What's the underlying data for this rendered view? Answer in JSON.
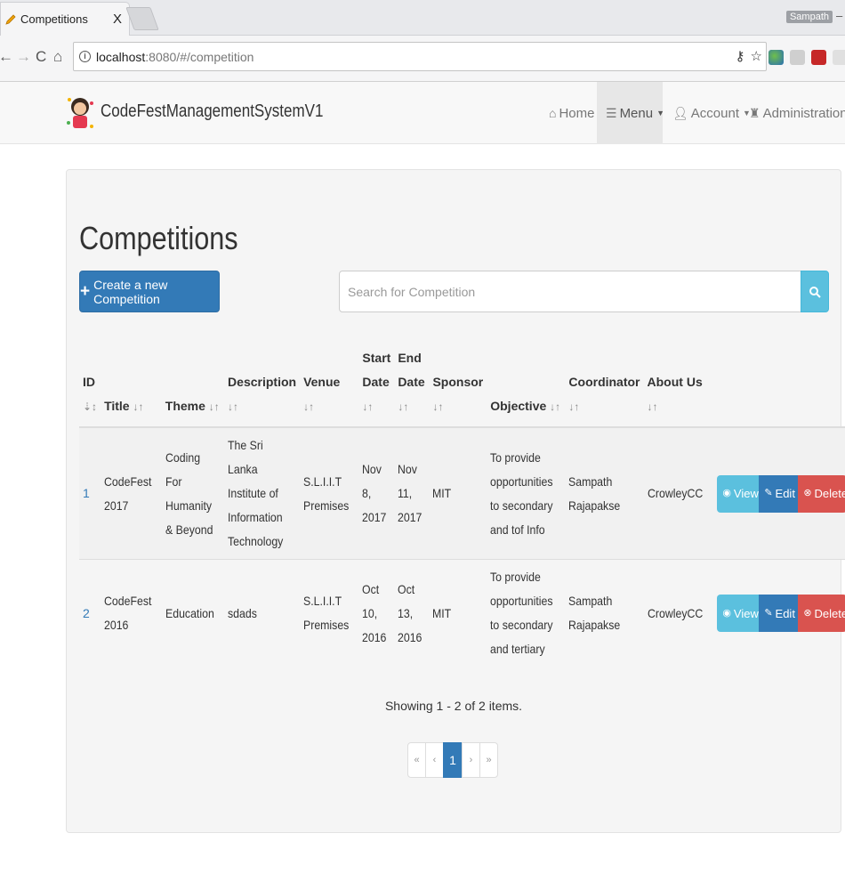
{
  "browser": {
    "tab_title": "Competitions",
    "tab_close": "X",
    "profile_name": "Sampath",
    "url_host": "localhost",
    "url_rest": ":8080/#/competition"
  },
  "navbar": {
    "brand": "CodeFestManagementSystemV1",
    "home": "Home",
    "menu": "Menu",
    "account": "Account",
    "administration": "Administration"
  },
  "page": {
    "title": "Competitions",
    "create_button": "Create a new Competition",
    "search_placeholder": "Search for Competition"
  },
  "table": {
    "headers": {
      "id": "ID",
      "title": "Title",
      "theme": "Theme",
      "description": "Description",
      "venue": "Venue",
      "start_date": "Start Date",
      "end_date": "End Date",
      "sponsor": "Sponsor",
      "objective": "Objective",
      "coordinator": "Coordinator",
      "about_us": "About Us"
    },
    "rows": [
      {
        "id": "1",
        "title": "CodeFest 2017",
        "theme": "Coding For Humanity & Beyond",
        "description": "The Sri Lanka Institute of Information Technology",
        "venue": "S.L.I.I.T Premises",
        "start_date": "Nov 8, 2017",
        "end_date": "Nov 11, 2017",
        "sponsor": "MIT",
        "objective": "To provide opportunities to secondary and tof Info",
        "coordinator": "Sampath Rajapakse",
        "about_us": "CrowleyCC"
      },
      {
        "id": "2",
        "title": "CodeFest 2016",
        "theme": "Education",
        "description": "sdads",
        "venue": "S.L.I.I.T Premises",
        "start_date": "Oct 10, 2016",
        "end_date": "Oct 13, 2016",
        "sponsor": "MIT",
        "objective": "To provide opportunities to secondary and tertiary",
        "coordinator": "Sampath Rajapakse",
        "about_us": "CrowleyCC"
      }
    ],
    "actions": {
      "view": "View",
      "edit": "Edit",
      "delete": "Delete"
    }
  },
  "footer": {
    "showing": "Showing 1 - 2 of 2 items.",
    "pages": [
      "«",
      "‹",
      "1",
      "›",
      "»"
    ],
    "current_page": "1"
  },
  "colors": {
    "primary": "#337ab7",
    "info": "#5bc0de",
    "danger": "#d9534f"
  }
}
